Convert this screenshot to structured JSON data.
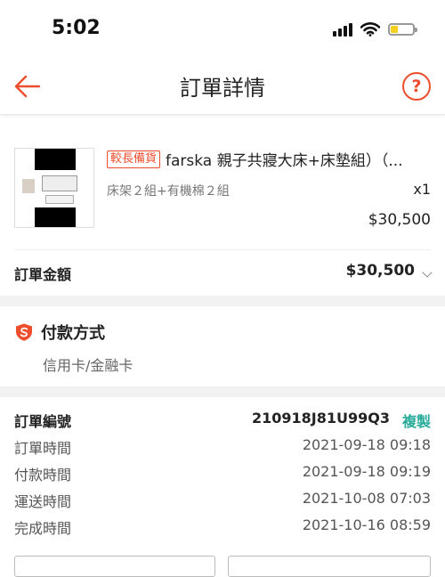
{
  "status_bar": {
    "time": "5:02",
    "signal_icon": "cellular-signal-icon",
    "wifi_icon": "wifi-icon",
    "battery_icon": "battery-low-icon",
    "battery_color": "#f4d020"
  },
  "header": {
    "title": "訂單詳情",
    "back_icon": "arrow-left-icon",
    "help_label": "?",
    "accent_color": "#ee4d2d"
  },
  "product": {
    "tag": "較長備貨",
    "name": "farska 親子共寢大床+床墊組）（...",
    "variant": "床架２組+有機棉２組",
    "quantity": "x1",
    "price": "$30,500"
  },
  "order_total": {
    "label": "訂單金額",
    "value": "$30,500"
  },
  "payment": {
    "icon": "shield-s-icon",
    "title": "付款方式",
    "method": "信用卡/金融卡"
  },
  "order_info": {
    "number_label": "訂單編號",
    "number_value": "210918J81U99Q3",
    "copy_label": "複製",
    "copy_color": "#26aa99",
    "rows": [
      {
        "label": "訂單時間",
        "value": "2021-09-18 09:18"
      },
      {
        "label": "付款時間",
        "value": "2021-09-18 09:19"
      },
      {
        "label": "運送時間",
        "value": "2021-10-08 07:03"
      },
      {
        "label": "完成時間",
        "value": "2021-10-16 08:59"
      }
    ]
  }
}
